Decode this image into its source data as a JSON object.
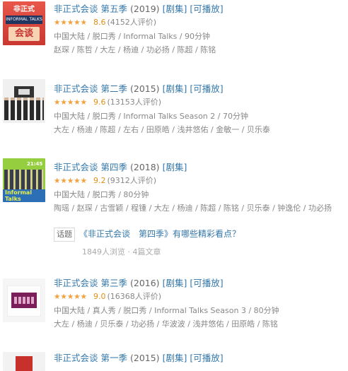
{
  "entries": [
    {
      "title": "非正式会谈 第五季",
      "year": "(2019)",
      "tags": [
        "[剧集]",
        "[可播放]"
      ],
      "rating": 8.6,
      "score": "8.6",
      "votes": "(4152人评价)",
      "meta": "中国大陆 / 脱口秀 / Informal Talks / 90分钟",
      "cast": "赵琛 / 陈哲 / 大左 / 杨迪 / 功必扬 / 陈超 / 陈铭",
      "poster_text": [
        "非正式",
        "INFORMAL TALKS",
        "会谈"
      ]
    },
    {
      "title": "非正式会谈 第二季",
      "year": "(2015)",
      "tags": [
        "[剧集]",
        "[可播放]"
      ],
      "rating": 9.6,
      "score": "9.6",
      "votes": "(13153人评价)",
      "meta": "中国大陆 / 脱口秀 / Informal Talks Season 2 / 70分钟",
      "cast": "大左 / 杨迪 / 陈超 / 左右 / 田原皓 / 浅井悠佑 / 金敏一 / 贝乐泰"
    },
    {
      "title": "非正式会谈 第四季",
      "year": "(2018)",
      "tags": [
        "[剧集]"
      ],
      "rating": 9.2,
      "score": "9.2",
      "votes": "(9312人评价)",
      "meta": "中国大陆 / 脱口秀 / 80分钟",
      "cast": "陶瑶 / 赵琛 / 古雪颖 / 程锺 / 大左 / 杨迪 / 陈超 / 陈铭 / 贝乐泰 / 钟逸伦 / 功必扬",
      "poster_text": [
        "21:45",
        "Informal",
        "Talks"
      ]
    },
    {
      "title": "非正式会谈 第三季",
      "year": "(2016)",
      "tags": [
        "[剧集]",
        "[可播放]"
      ],
      "rating": 9.0,
      "score": "9.0",
      "votes": "(16368人评价)",
      "meta": "中国大陆 / 真人秀 / 脱口秀 / Informal Talks Season 3 / 80分钟",
      "cast": "大左 / 杨迪 / 贝乐泰 / 功必扬 / 华波波 / 浅井悠佑 / 田原皓 / 陈铭"
    },
    {
      "title": "非正式会谈 第一季",
      "year": "(2015)",
      "tags": [
        "[剧集]",
        "[可播放]"
      ]
    }
  ],
  "topic": {
    "badge": "话题",
    "title": "《非正式会谈　第四季》有哪些精彩看点？",
    "stats": "1849人浏览 · 4篇文章"
  },
  "colors": {
    "link": "#3377aa",
    "star": "#f4a13a",
    "score": "#e09015",
    "meta": "#888888"
  }
}
